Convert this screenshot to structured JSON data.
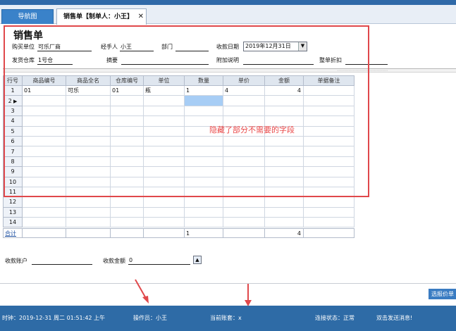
{
  "tabs": {
    "nav_label": "导航图",
    "sales_label": "销售单【制单人：小王】",
    "close_glyph": "✕"
  },
  "form": {
    "title": "销售单",
    "buyer_label": "购买单位",
    "buyer_value": "可乐厂商",
    "handler_label": "经手人",
    "handler_value": "小王",
    "dept_label": "部门",
    "date_label": "收款日期",
    "date_value": "2019年12月31日",
    "warehouse_label": "发货仓库",
    "warehouse_value": "1号仓",
    "summary_label": "摘要",
    "note_label": "附加说明",
    "discount_label": "整单折扣"
  },
  "grid": {
    "columns": [
      "行号",
      "商品编号",
      "商品全名",
      "仓库编号",
      "单位",
      "数量",
      "单价",
      "金额",
      "单据备注"
    ],
    "rows": [
      {
        "n": "1",
        "code": "01",
        "name": "可乐",
        "wh": "01",
        "unit": "瓶",
        "qty": "1",
        "price": "4",
        "amount": "4",
        "remark": ""
      },
      {
        "n": "2",
        "code": "",
        "name": "",
        "wh": "",
        "unit": "",
        "qty": "",
        "price": "",
        "amount": "",
        "remark": ""
      },
      {
        "n": "3",
        "code": "",
        "name": "",
        "wh": "",
        "unit": "",
        "qty": "",
        "price": "",
        "amount": "",
        "remark": ""
      },
      {
        "n": "4",
        "code": "",
        "name": "",
        "wh": "",
        "unit": "",
        "qty": "",
        "price": "",
        "amount": "",
        "remark": ""
      },
      {
        "n": "5",
        "code": "",
        "name": "",
        "wh": "",
        "unit": "",
        "qty": "",
        "price": "",
        "amount": "",
        "remark": ""
      },
      {
        "n": "6",
        "code": "",
        "name": "",
        "wh": "",
        "unit": "",
        "qty": "",
        "price": "",
        "amount": "",
        "remark": ""
      },
      {
        "n": "7",
        "code": "",
        "name": "",
        "wh": "",
        "unit": "",
        "qty": "",
        "price": "",
        "amount": "",
        "remark": ""
      },
      {
        "n": "8",
        "code": "",
        "name": "",
        "wh": "",
        "unit": "",
        "qty": "",
        "price": "",
        "amount": "",
        "remark": ""
      },
      {
        "n": "9",
        "code": "",
        "name": "",
        "wh": "",
        "unit": "",
        "qty": "",
        "price": "",
        "amount": "",
        "remark": ""
      },
      {
        "n": "10",
        "code": "",
        "name": "",
        "wh": "",
        "unit": "",
        "qty": "",
        "price": "",
        "amount": "",
        "remark": ""
      },
      {
        "n": "11",
        "code": "",
        "name": "",
        "wh": "",
        "unit": "",
        "qty": "",
        "price": "",
        "amount": "",
        "remark": ""
      },
      {
        "n": "12",
        "code": "",
        "name": "",
        "wh": "",
        "unit": "",
        "qty": "",
        "price": "",
        "amount": "",
        "remark": ""
      },
      {
        "n": "13",
        "code": "",
        "name": "",
        "wh": "",
        "unit": "",
        "qty": "",
        "price": "",
        "amount": "",
        "remark": ""
      },
      {
        "n": "14",
        "code": "",
        "name": "",
        "wh": "",
        "unit": "",
        "qty": "",
        "price": "",
        "amount": "",
        "remark": ""
      }
    ],
    "total_label": "合计",
    "total_qty": "1",
    "total_amount": "4"
  },
  "annotation": {
    "text": "隐藏了部分不需要的字段",
    "color": "#e0484b"
  },
  "footer_fields": {
    "account_label": "收款账户",
    "amount_label": "收款金额",
    "amount_value": "0"
  },
  "buttons": {
    "quote": "选报价单"
  },
  "status": {
    "clock": "时钟：2019-12-31 周二 01:51:42 上午",
    "operator": "操作员：小王",
    "account_set": "当前账套：x",
    "connection": "连接状态：正常",
    "message": "双击发送消息!"
  },
  "colors": {
    "accent": "#2e6ba6",
    "annotation": "#e0484b",
    "selected_cell": "#a7cdf5"
  }
}
